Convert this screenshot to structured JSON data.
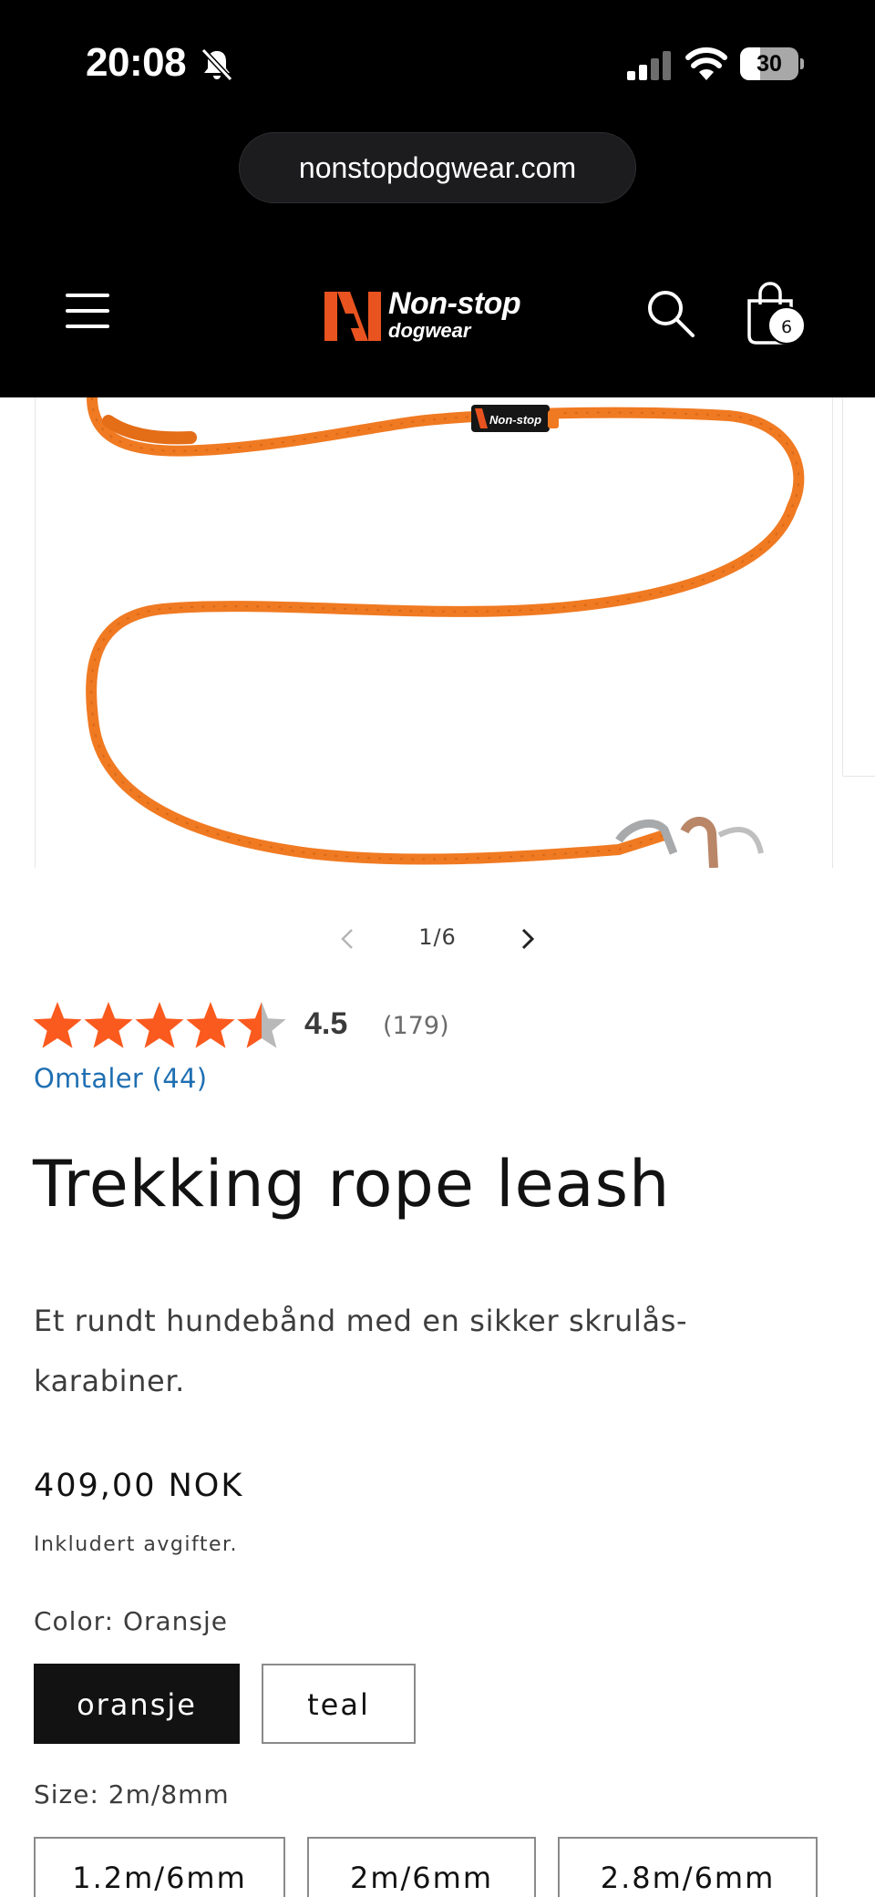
{
  "status_bar": {
    "time": "20:08",
    "battery": "30",
    "icons": [
      "bell-slash-icon",
      "cellular-signal-icon",
      "wifi-icon",
      "battery-icon"
    ]
  },
  "browser": {
    "url": "nonstopdogwear.com"
  },
  "header": {
    "brand_line1": "Non-stop",
    "brand_line2": "dogwear",
    "cart_count": "6",
    "icons": [
      "menu-icon",
      "search-icon",
      "shopping-bag-icon"
    ]
  },
  "gallery": {
    "counter": "1/6",
    "leash_tag_text": "Non-stop",
    "accent_color": "#f07a22"
  },
  "rating": {
    "average": "4.5",
    "count": "(179)",
    "stars": 4.5,
    "star_color": "#fa5a1e",
    "reviews_link": "Omtaler (44)"
  },
  "product": {
    "title": "Trekking rope leash",
    "description": "Et rundt hundebånd med en sikker skrulås-karabiner.",
    "price": "409,00 NOK",
    "tax_note": "Inkludert avgifter.",
    "color_label": "Color: Oransje",
    "color_options": [
      {
        "label": "oransje",
        "selected": true
      },
      {
        "label": "teal",
        "selected": false
      }
    ],
    "size_label": "Size: 2m/8mm",
    "size_options": [
      {
        "label": "1.2m/6mm"
      },
      {
        "label": "2m/6mm"
      },
      {
        "label": "2.8m/6mm"
      }
    ]
  }
}
